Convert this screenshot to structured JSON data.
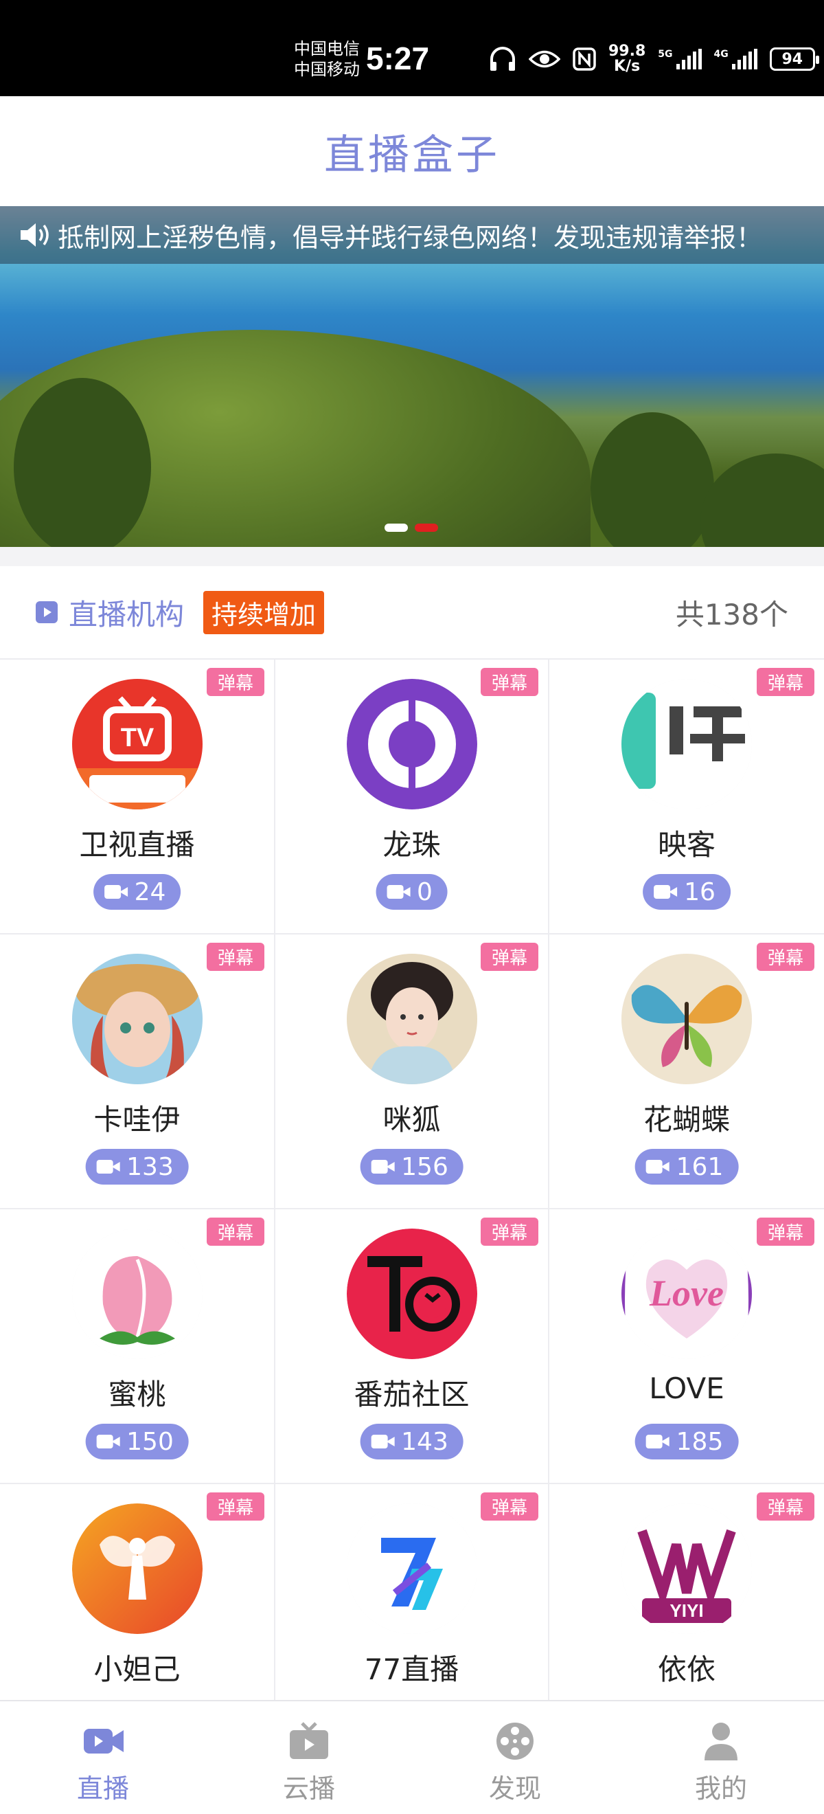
{
  "status_bar": {
    "carrier_1": "中国电信",
    "carrier_2": "中国移动",
    "time": "5:27",
    "speed_value": "99.8",
    "speed_unit": "K/s",
    "net_1": "5G",
    "net_2": "4G",
    "battery": "94"
  },
  "header": {
    "title": "直播盒子"
  },
  "banner": {
    "notice": "抵制网上淫秽色情，倡导并践行绿色网络！发现违规请举报！",
    "slide_count": 2,
    "active_slide": 2
  },
  "section": {
    "title": "直播机构",
    "tag": "持续增加",
    "count": "共138个"
  },
  "platforms": [
    {
      "name": "卫视直播",
      "count": "24",
      "badge": "弹幕",
      "icon": "tv-logo-icon"
    },
    {
      "name": "龙珠",
      "count": "0",
      "badge": "弹幕",
      "icon": "longzhu-logo-icon"
    },
    {
      "name": "映客",
      "count": "16",
      "badge": "弹幕",
      "icon": "yingke-logo-icon"
    },
    {
      "name": "卡哇伊",
      "count": "133",
      "badge": "弹幕",
      "icon": "kawayi-avatar-icon"
    },
    {
      "name": "咪狐",
      "count": "156",
      "badge": "弹幕",
      "icon": "mihu-avatar-icon"
    },
    {
      "name": "花蝴蝶",
      "count": "161",
      "badge": "弹幕",
      "icon": "butterfly-logo-icon"
    },
    {
      "name": "蜜桃",
      "count": "150",
      "badge": "弹幕",
      "icon": "peach-logo-icon"
    },
    {
      "name": "番茄社区",
      "count": "143",
      "badge": "弹幕",
      "icon": "tomato-logo-icon"
    },
    {
      "name": "LOVE",
      "count": "185",
      "badge": "弹幕",
      "icon": "love-logo-icon"
    },
    {
      "name": "小妲己",
      "count": "",
      "badge": "弹幕",
      "icon": "xiaodaji-logo-icon"
    },
    {
      "name": "77直播",
      "count": "",
      "badge": "弹幕",
      "icon": "seventy-seven-logo-icon"
    },
    {
      "name": "依依",
      "count": "",
      "badge": "弹幕",
      "icon": "yiyi-logo-icon"
    }
  ],
  "tabs": [
    {
      "label": "直播",
      "icon": "video-camera-icon",
      "active": true
    },
    {
      "label": "云播",
      "icon": "tv-icon",
      "active": false
    },
    {
      "label": "发现",
      "icon": "film-reel-icon",
      "active": false
    },
    {
      "label": "我的",
      "icon": "user-icon",
      "active": false
    }
  ],
  "colors": {
    "accent": "#7d87d9",
    "tag": "#f05a14",
    "badge": "#f36fa0",
    "pill": "#8b92e4"
  }
}
